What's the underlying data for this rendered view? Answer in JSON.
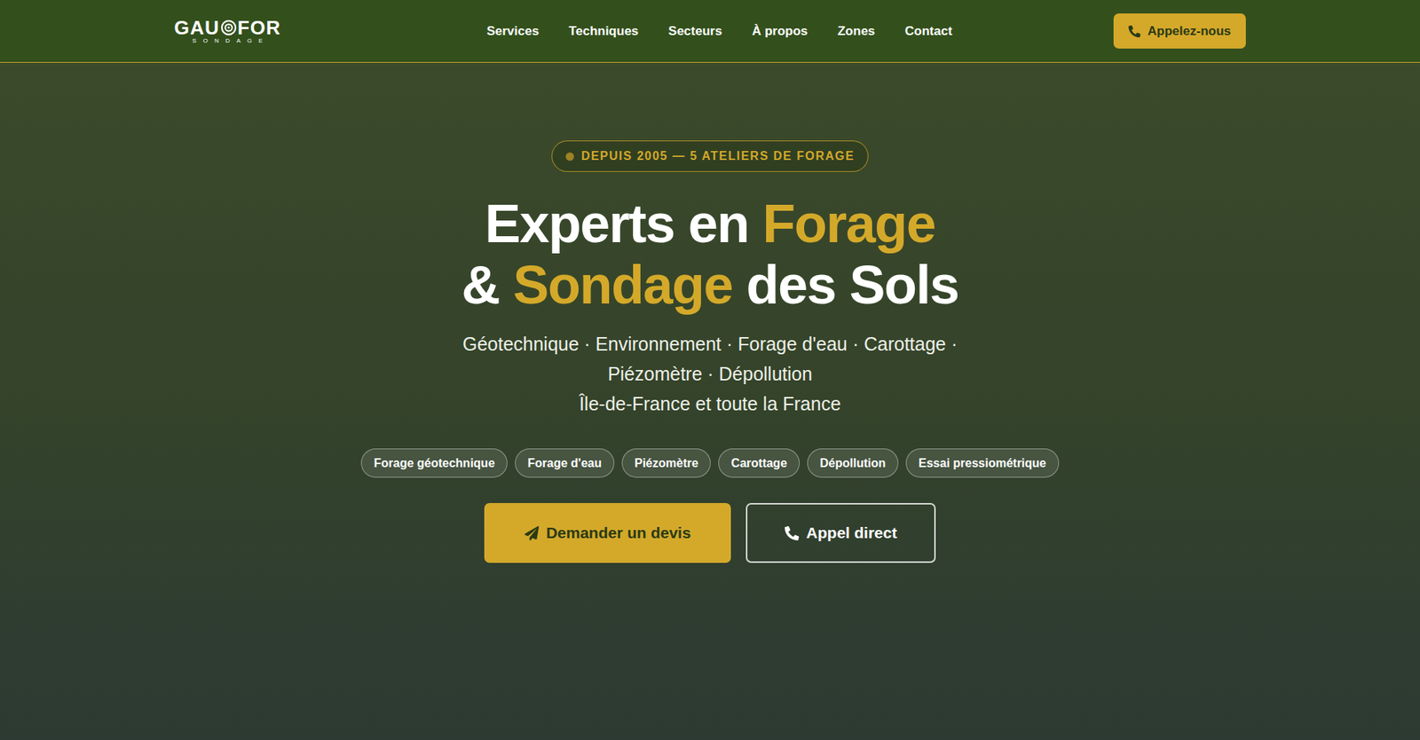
{
  "header": {
    "logo": {
      "left": "GAU",
      "right": "FOR",
      "tagline": "SONDAGE"
    },
    "nav": [
      "Services",
      "Techniques",
      "Secteurs",
      "À propos",
      "Zones",
      "Contact"
    ],
    "call_button": "Appelez-nous"
  },
  "hero": {
    "badge": "DEPUIS 2005 — 5 ATELIERS DE FORAGE",
    "heading": [
      [
        {
          "text": "Experts en ",
          "highlight": false
        },
        {
          "text": "Forage",
          "highlight": true
        }
      ],
      [
        {
          "text": "& ",
          "highlight": false
        },
        {
          "text": "Sondage",
          "highlight": true
        },
        {
          "text": " des Sols",
          "highlight": false
        }
      ]
    ],
    "subtitle": [
      "Géotechnique · Environnement · Forage d'eau · Carottage ·",
      "Piézomètre · Dépollution",
      "Île-de-France et toute la France"
    ],
    "tags": [
      "Forage géotechnique",
      "Forage d'eau",
      "Piézomètre",
      "Carottage",
      "Dépollution",
      "Essai pressiométrique"
    ],
    "buttons": {
      "quote": "Demander un devis",
      "call": "Appel direct"
    }
  }
}
